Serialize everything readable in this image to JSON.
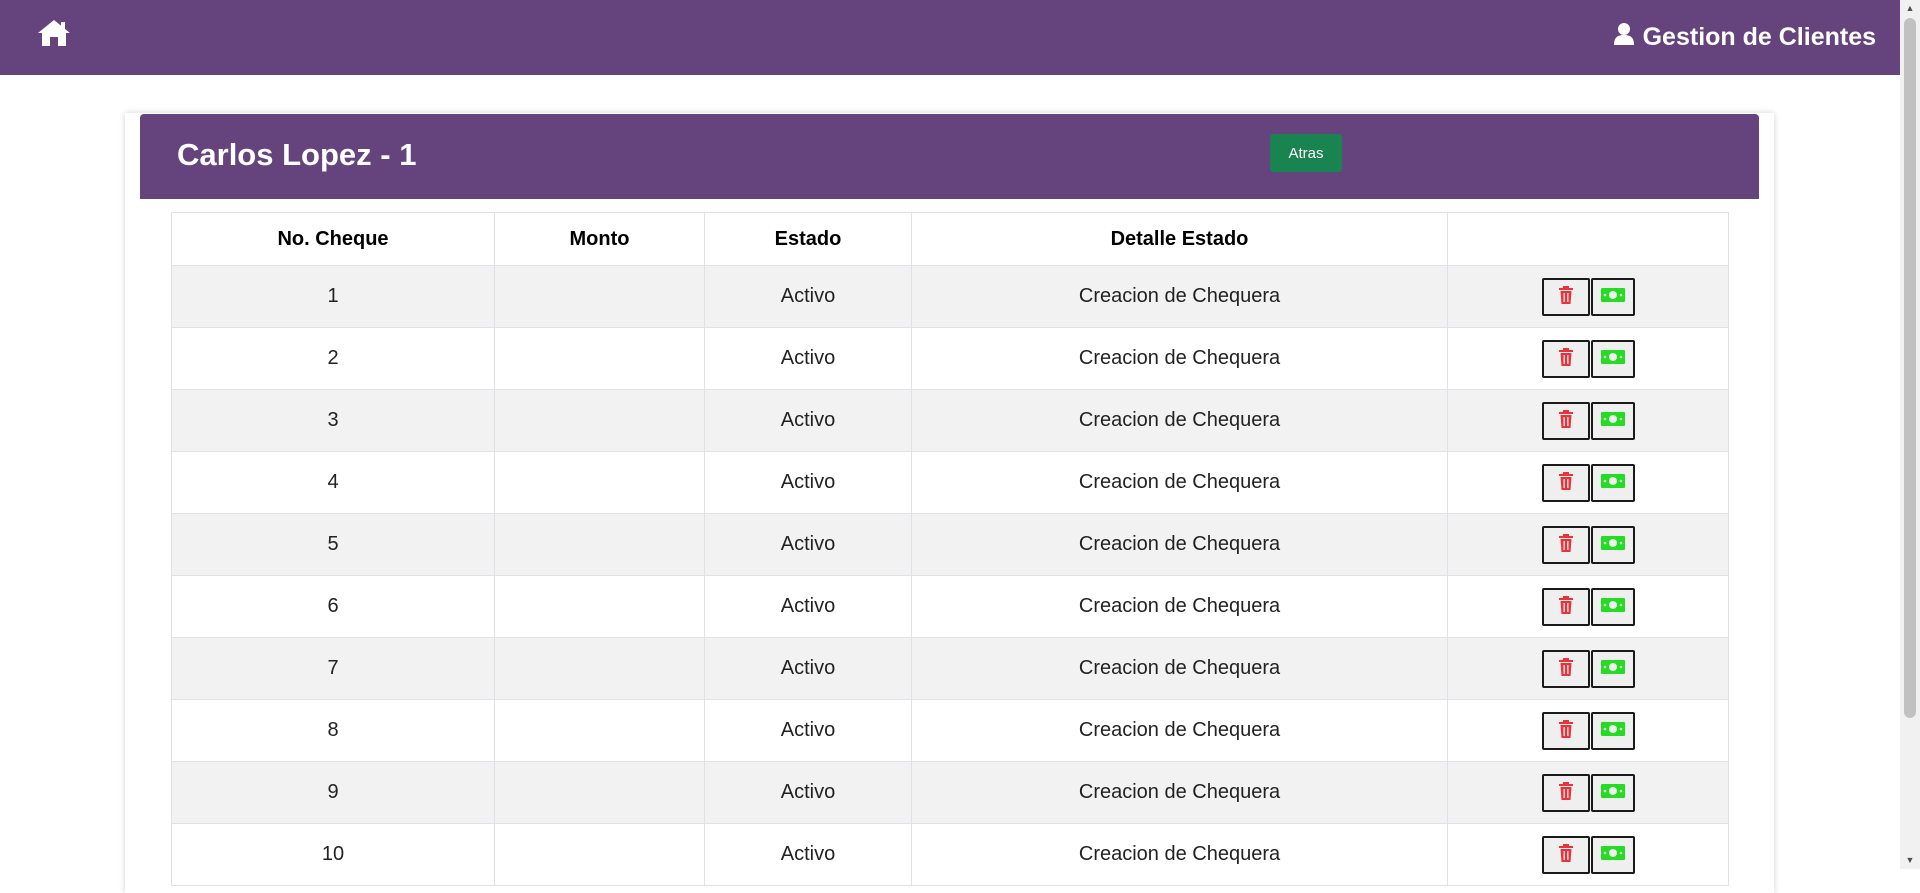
{
  "navbar": {
    "home_icon": "home-icon",
    "brand_icon": "user-icon",
    "brand_label": "Gestion de Clientes"
  },
  "card": {
    "title": "Carlos Lopez - 1",
    "back_label": "Atras"
  },
  "table": {
    "headers": [
      "No. Cheque",
      "Monto",
      "Estado",
      "Detalle Estado",
      ""
    ],
    "rows": [
      {
        "cheque": "1",
        "monto": "",
        "estado": "Activo",
        "detalle": "Creacion de Chequera"
      },
      {
        "cheque": "2",
        "monto": "",
        "estado": "Activo",
        "detalle": "Creacion de Chequera"
      },
      {
        "cheque": "3",
        "monto": "",
        "estado": "Activo",
        "detalle": "Creacion de Chequera"
      },
      {
        "cheque": "4",
        "monto": "",
        "estado": "Activo",
        "detalle": "Creacion de Chequera"
      },
      {
        "cheque": "5",
        "monto": "",
        "estado": "Activo",
        "detalle": "Creacion de Chequera"
      },
      {
        "cheque": "6",
        "monto": "",
        "estado": "Activo",
        "detalle": "Creacion de Chequera"
      },
      {
        "cheque": "7",
        "monto": "",
        "estado": "Activo",
        "detalle": "Creacion de Chequera"
      },
      {
        "cheque": "8",
        "monto": "",
        "estado": "Activo",
        "detalle": "Creacion de Chequera"
      },
      {
        "cheque": "9",
        "monto": "",
        "estado": "Activo",
        "detalle": "Creacion de Chequera"
      },
      {
        "cheque": "10",
        "monto": "",
        "estado": "Activo",
        "detalle": "Creacion de Chequera"
      }
    ],
    "action_icons": [
      "trash-icon",
      "money-bill-icon"
    ]
  },
  "colors": {
    "primary": "#65447d",
    "success": "#1a8451",
    "danger": "#e8323c",
    "money": "#22dd22"
  }
}
